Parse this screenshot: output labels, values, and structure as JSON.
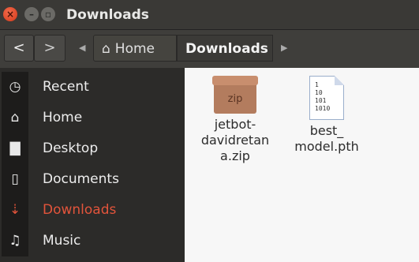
{
  "window": {
    "title": "Downloads",
    "close_glyph": "×",
    "minimize_glyph": "–",
    "maximize_glyph": "▫"
  },
  "toolbar": {
    "back_glyph": "<",
    "forward_glyph": ">",
    "crumb_left_glyph": "◀",
    "crumb_right_glyph": "▶",
    "breadcrumbs": [
      {
        "label": "Home",
        "icon": "home-icon",
        "glyph": "⌂"
      },
      {
        "label": "Downloads"
      }
    ]
  },
  "sidebar": {
    "items": [
      {
        "label": "Recent",
        "icon": "clock-icon",
        "glyph": "◷"
      },
      {
        "label": "Home",
        "icon": "home-icon",
        "glyph": "⌂"
      },
      {
        "label": "Desktop",
        "icon": "folder-icon",
        "glyph": "▇"
      },
      {
        "label": "Documents",
        "icon": "document-icon",
        "glyph": "▯"
      },
      {
        "label": "Downloads",
        "icon": "download-icon",
        "glyph": "⇣"
      },
      {
        "label": "Music",
        "icon": "music-icon",
        "glyph": "♫"
      }
    ]
  },
  "files": [
    {
      "name_lines": [
        "jetbot-",
        "davidretan",
        "a.zip"
      ],
      "icon": "zip-archive-icon",
      "icon_text": "zip"
    },
    {
      "name_lines": [
        "best_",
        "model.pth"
      ],
      "icon": "binary-file-icon",
      "icon_text": [
        "1",
        "10",
        "101",
        "1010"
      ]
    }
  ],
  "colors": {
    "accent": "#e2543b",
    "sidebar_bg": "#2c2b29",
    "main_bg": "#f7f7f7"
  }
}
